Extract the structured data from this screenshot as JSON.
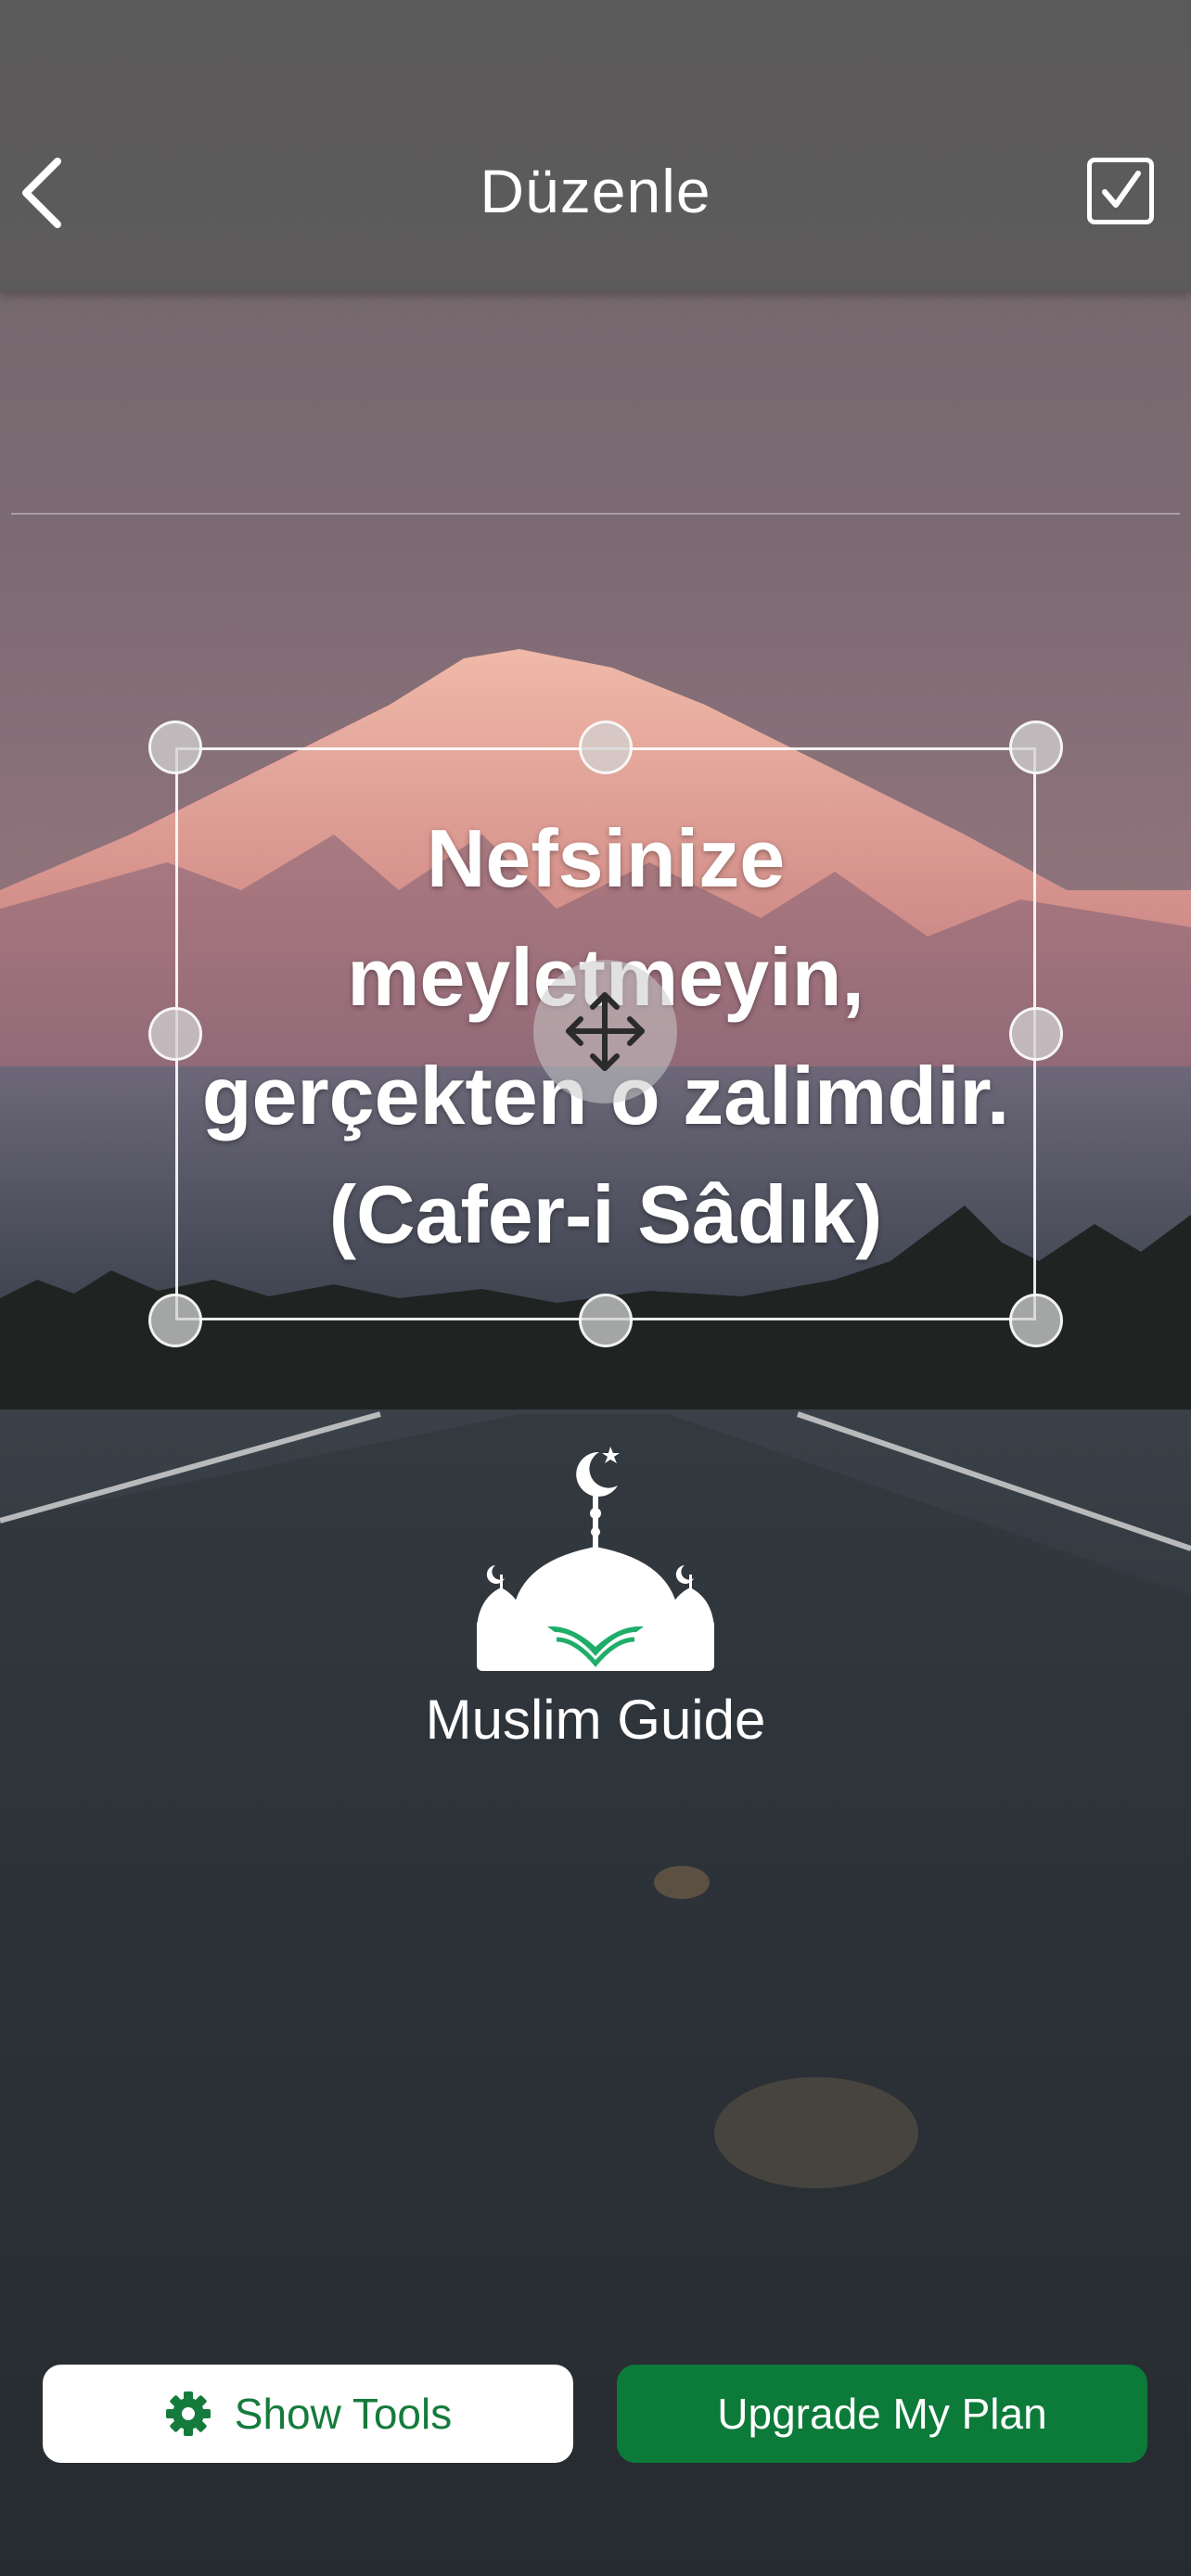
{
  "header": {
    "title": "Düzenle",
    "back_icon": "chevron-left-icon",
    "confirm_icon": "checkbox-checked-icon"
  },
  "quote": {
    "lines": [
      "Nefsinize",
      "meyletmeyin,",
      "gerçekten o zalimdir.",
      "(Cafer-i Sâdık)"
    ]
  },
  "brand": {
    "name": "Muslim Guide",
    "logo_icon": "mosque-book-logo"
  },
  "actions": {
    "show_tools_label": "Show Tools",
    "show_tools_icon": "gear-icon",
    "upgrade_label": "Upgrade My Plan"
  },
  "colors": {
    "brand_green": "#0c7a39",
    "text_white": "#ffffff"
  }
}
